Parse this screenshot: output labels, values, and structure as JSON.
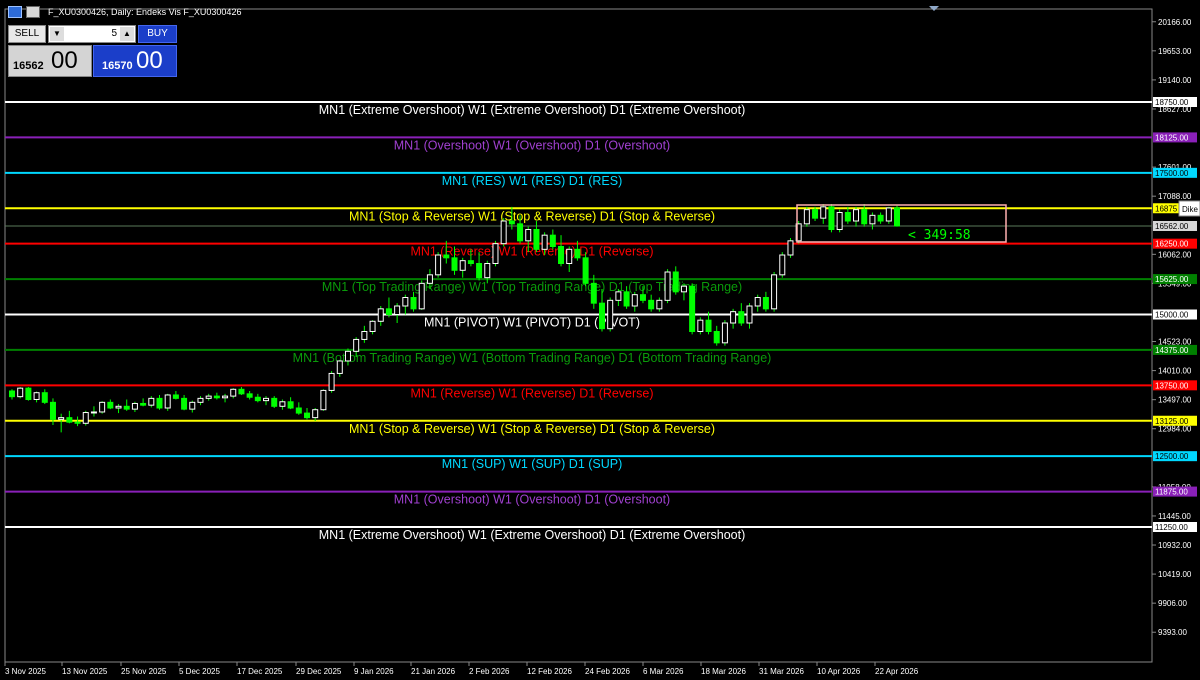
{
  "window": {
    "title": "F_XU0300426, Daily: Endeks Vis F_XU0300426"
  },
  "trade_panel": {
    "sell_label": "SELL",
    "buy_label": "BUY",
    "lot": "5",
    "bid_main": "16562",
    "bid_frac": "00",
    "ask_main": "16570",
    "ask_frac": "00"
  },
  "chart_data": {
    "type": "candlestick",
    "title": "F_XU0300426, Daily: Endeks Vis F_XU0300426",
    "y_axis_ticks": [
      "20166.00",
      "19653.00",
      "19140.00",
      "18627.00",
      "17601.00",
      "17088.00",
      "16062.00",
      "15549.00",
      "14523.00",
      "14010.00",
      "13497.00",
      "12984.00",
      "11958.00",
      "11445.00",
      "10932.00",
      "10419.00",
      "9906.00",
      "9393.00"
    ],
    "x_axis_ticks": [
      "3 Nov 2025",
      "13 Nov 2025",
      "25 Nov 2025",
      "5 Dec 2025",
      "17 Dec 2025",
      "29 Dec 2025",
      "9 Jan 2026",
      "21 Jan 2026",
      "2 Feb 2026",
      "12 Feb 2026",
      "24 Feb 2026",
      "6 Mar 2026",
      "18 Mar 2026",
      "31 Mar 2026",
      "10 Apr 2026",
      "22 Apr 2026"
    ],
    "levels": [
      {
        "price": 18750,
        "label": "18750.00",
        "text": "MN1 (Extreme Overshoot) W1 (Extreme Overshoot) D1 (Extreme Overshoot)",
        "color": "#ffffff",
        "text_color": "#ffffff"
      },
      {
        "price": 18125,
        "label": "18125.00",
        "text": "MN1 (Overshoot) W1 (Overshoot) D1 (Overshoot)",
        "color": "#8a20b8",
        "text_color": "#a040d0"
      },
      {
        "price": 17500,
        "label": "17500.00",
        "text": "MN1 (RES) W1 (RES) D1 (RES)",
        "color": "#00d8ff",
        "text_color": "#00d8ff"
      },
      {
        "price": 16875,
        "label": "16875",
        "text": "MN1 (Stop & Reverse) W1 (Stop & Reverse) D1 (Stop & Reverse)",
        "color": "#ffff00",
        "text_color": "#ffff00"
      },
      {
        "price": 16250,
        "label": "16250.00",
        "text": "MN1 (Reverse) W1 (Reverse) D1 (Reverse)",
        "color": "#ff0000",
        "text_color": "#ff0000"
      },
      {
        "price": 15625,
        "label": "15625.00",
        "text": "MN1 (Top Trading Range) W1 (Top Trading Range) D1 (Top Trading Range)",
        "color": "#008000",
        "text_color": "#0a9a0a"
      },
      {
        "price": 15000,
        "label": "15000.00",
        "text": "MN1 (PIVOT) W1 (PIVOT) D1 (PIVOT)",
        "color": "#ffffff",
        "text_color": "#ffffff"
      },
      {
        "price": 14375,
        "label": "14375.00",
        "text": "MN1 (Bottom Trading Range) W1 (Bottom Trading Range) D1 (Bottom Trading Range)",
        "color": "#008000",
        "text_color": "#0a9a0a"
      },
      {
        "price": 13750,
        "label": "13750.00",
        "text": "MN1 (Reverse) W1 (Reverse) D1 (Reverse)",
        "color": "#ff0000",
        "text_color": "#ff0000"
      },
      {
        "price": 13125,
        "label": "13125.00",
        "text": "MN1 (Stop & Reverse) W1 (Stop & Reverse) D1 (Stop & Reverse)",
        "color": "#ffff00",
        "text_color": "#ffff00"
      },
      {
        "price": 12500,
        "label": "12500.00",
        "text": "MN1 (SUP) W1 (SUP) D1 (SUP)",
        "color": "#00d8ff",
        "text_color": "#00d8ff"
      },
      {
        "price": 11875,
        "label": "11875.00",
        "text": "MN1 (Overshoot) W1 (Overshoot) D1 (Overshoot)",
        "color": "#8a20b8",
        "text_color": "#a040d0"
      },
      {
        "price": 11250,
        "label": "11250.00",
        "text": "MN1 (Extreme Overshoot) W1 (Extreme Overshoot) D1 (Extreme Overshoot)",
        "color": "#ffffff",
        "text_color": "#ffffff"
      }
    ],
    "current_price": {
      "price": 16562,
      "label": "16562.00"
    },
    "timer_text": "< 349:58",
    "tooltip_text": "Dike",
    "candle_colors": {
      "up": "#ffffff",
      "down": "#00ff00"
    },
    "ohlc": [
      [
        13650,
        13680,
        13500,
        13550
      ],
      [
        13550,
        13720,
        13520,
        13700
      ],
      [
        13700,
        13720,
        13480,
        13500
      ],
      [
        13500,
        13640,
        13450,
        13620
      ],
      [
        13620,
        13680,
        13420,
        13450
      ],
      [
        13450,
        13520,
        13050,
        13150
      ],
      [
        13150,
        13250,
        12920,
        13180
      ],
      [
        13180,
        13300,
        13080,
        13100
      ],
      [
        13100,
        13200,
        13030,
        13080
      ],
      [
        13080,
        13300,
        13040,
        13270
      ],
      [
        13270,
        13380,
        13200,
        13280
      ],
      [
        13280,
        13470,
        13250,
        13450
      ],
      [
        13450,
        13500,
        13330,
        13350
      ],
      [
        13350,
        13420,
        13260,
        13380
      ],
      [
        13380,
        13500,
        13300,
        13330
      ],
      [
        13330,
        13460,
        13280,
        13430
      ],
      [
        13430,
        13520,
        13380,
        13400
      ],
      [
        13400,
        13560,
        13360,
        13520
      ],
      [
        13520,
        13580,
        13320,
        13350
      ],
      [
        13350,
        13600,
        13300,
        13580
      ],
      [
        13580,
        13650,
        13500,
        13520
      ],
      [
        13520,
        13580,
        13310,
        13330
      ],
      [
        13330,
        13480,
        13270,
        13450
      ],
      [
        13450,
        13560,
        13400,
        13520
      ],
      [
        13520,
        13600,
        13480,
        13560
      ],
      [
        13560,
        13620,
        13500,
        13530
      ],
      [
        13530,
        13600,
        13450,
        13560
      ],
      [
        13560,
        13700,
        13520,
        13680
      ],
      [
        13680,
        13720,
        13580,
        13600
      ],
      [
        13600,
        13650,
        13500,
        13540
      ],
      [
        13540,
        13600,
        13450,
        13480
      ],
      [
        13480,
        13560,
        13400,
        13520
      ],
      [
        13520,
        13560,
        13350,
        13380
      ],
      [
        13380,
        13500,
        13320,
        13460
      ],
      [
        13460,
        13540,
        13330,
        13350
      ],
      [
        13350,
        13450,
        13230,
        13260
      ],
      [
        13260,
        13350,
        13150,
        13180
      ],
      [
        13180,
        13350,
        13120,
        13320
      ],
      [
        13320,
        13680,
        13300,
        13660
      ],
      [
        13660,
        14000,
        13620,
        13960
      ],
      [
        13960,
        14200,
        13900,
        14180
      ],
      [
        14180,
        14400,
        14100,
        14350
      ],
      [
        14350,
        14600,
        14250,
        14560
      ],
      [
        14560,
        14800,
        14500,
        14700
      ],
      [
        14700,
        14900,
        14650,
        14880
      ],
      [
        14880,
        15150,
        14800,
        15100
      ],
      [
        15100,
        15300,
        14950,
        15000
      ],
      [
        15000,
        15200,
        14850,
        15150
      ],
      [
        15150,
        15350,
        15000,
        15300
      ],
      [
        15300,
        15400,
        15050,
        15100
      ],
      [
        15100,
        15600,
        15080,
        15550
      ],
      [
        15550,
        15800,
        15450,
        15700
      ],
      [
        15700,
        16100,
        15650,
        16050
      ],
      [
        16050,
        16300,
        15900,
        16000
      ],
      [
        16000,
        16200,
        15700,
        15780
      ],
      [
        15780,
        16000,
        15650,
        15950
      ],
      [
        15950,
        16150,
        15850,
        15900
      ],
      [
        15900,
        16100,
        15600,
        15650
      ],
      [
        15650,
        15950,
        15550,
        15900
      ],
      [
        15900,
        16300,
        15850,
        16250
      ],
      [
        16250,
        16700,
        16200,
        16650
      ],
      [
        16650,
        16900,
        16500,
        16600
      ],
      [
        16600,
        16750,
        16250,
        16300
      ],
      [
        16300,
        16550,
        16100,
        16500
      ],
      [
        16500,
        16650,
        16100,
        16150
      ],
      [
        16150,
        16450,
        16050,
        16400
      ],
      [
        16400,
        16500,
        16150,
        16200
      ],
      [
        16200,
        16400,
        15850,
        15900
      ],
      [
        15900,
        16200,
        15750,
        16150
      ],
      [
        16150,
        16300,
        15950,
        16000
      ],
      [
        16000,
        16100,
        15500,
        15550
      ],
      [
        15550,
        15700,
        15100,
        15200
      ],
      [
        15200,
        15450,
        14700,
        14750
      ],
      [
        14750,
        15300,
        14700,
        15250
      ],
      [
        15250,
        15450,
        15150,
        15400
      ],
      [
        15400,
        15500,
        15100,
        15150
      ],
      [
        15150,
        15400,
        15050,
        15350
      ],
      [
        15350,
        15500,
        15200,
        15250
      ],
      [
        15250,
        15350,
        15050,
        15100
      ],
      [
        15100,
        15300,
        15050,
        15250
      ],
      [
        15250,
        15800,
        15200,
        15750
      ],
      [
        15750,
        15850,
        15350,
        15400
      ],
      [
        15400,
        15550,
        15250,
        15500
      ],
      [
        15500,
        15550,
        14650,
        14700
      ],
      [
        14700,
        14950,
        14650,
        14900
      ],
      [
        14900,
        15050,
        14650,
        14700
      ],
      [
        14700,
        14800,
        14450,
        14500
      ],
      [
        14500,
        14900,
        14450,
        14850
      ],
      [
        14850,
        15100,
        14750,
        15050
      ],
      [
        15050,
        15200,
        14800,
        14850
      ],
      [
        14850,
        15200,
        14750,
        15150
      ],
      [
        15150,
        15350,
        15050,
        15300
      ],
      [
        15300,
        15400,
        15050,
        15100
      ],
      [
        15100,
        15750,
        15050,
        15700
      ],
      [
        15700,
        16100,
        15650,
        16050
      ],
      [
        16050,
        16350,
        16000,
        16300
      ],
      [
        16300,
        16650,
        16250,
        16600
      ],
      [
        16600,
        16900,
        16550,
        16850
      ],
      [
        16850,
        16900,
        16650,
        16700
      ],
      [
        16700,
        16950,
        16600,
        16900
      ],
      [
        16900,
        16950,
        16450,
        16500
      ],
      [
        16500,
        16850,
        16450,
        16800
      ],
      [
        16800,
        16900,
        16600,
        16650
      ],
      [
        16650,
        16900,
        16550,
        16850
      ],
      [
        16850,
        16950,
        16550,
        16600
      ],
      [
        16600,
        16800,
        16500,
        16750
      ],
      [
        16750,
        16800,
        16600,
        16650
      ],
      [
        16650,
        16900,
        16600,
        16880
      ],
      [
        16880,
        16920,
        16550,
        16562
      ]
    ]
  }
}
